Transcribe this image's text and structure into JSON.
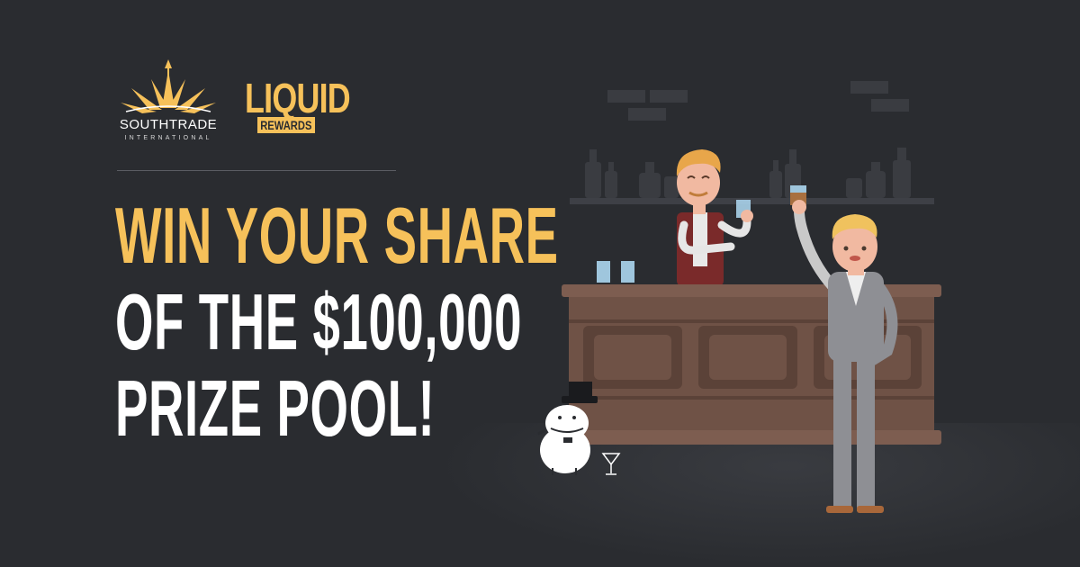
{
  "logos": {
    "southtrade": {
      "name": "SOUTHTRADE",
      "sub": "INTERNATIONAL"
    },
    "liquid": {
      "name": "LIQUID",
      "badge": "REWARDS"
    }
  },
  "headline": {
    "line1": "WIN YOUR SHARE",
    "line2": "OF THE $100,000",
    "line3": "PRIZE POOL!"
  },
  "colors": {
    "background": "#2a2c30",
    "accent": "#f6c15a",
    "text": "#ffffff",
    "bar_wood": "#6f5246"
  }
}
